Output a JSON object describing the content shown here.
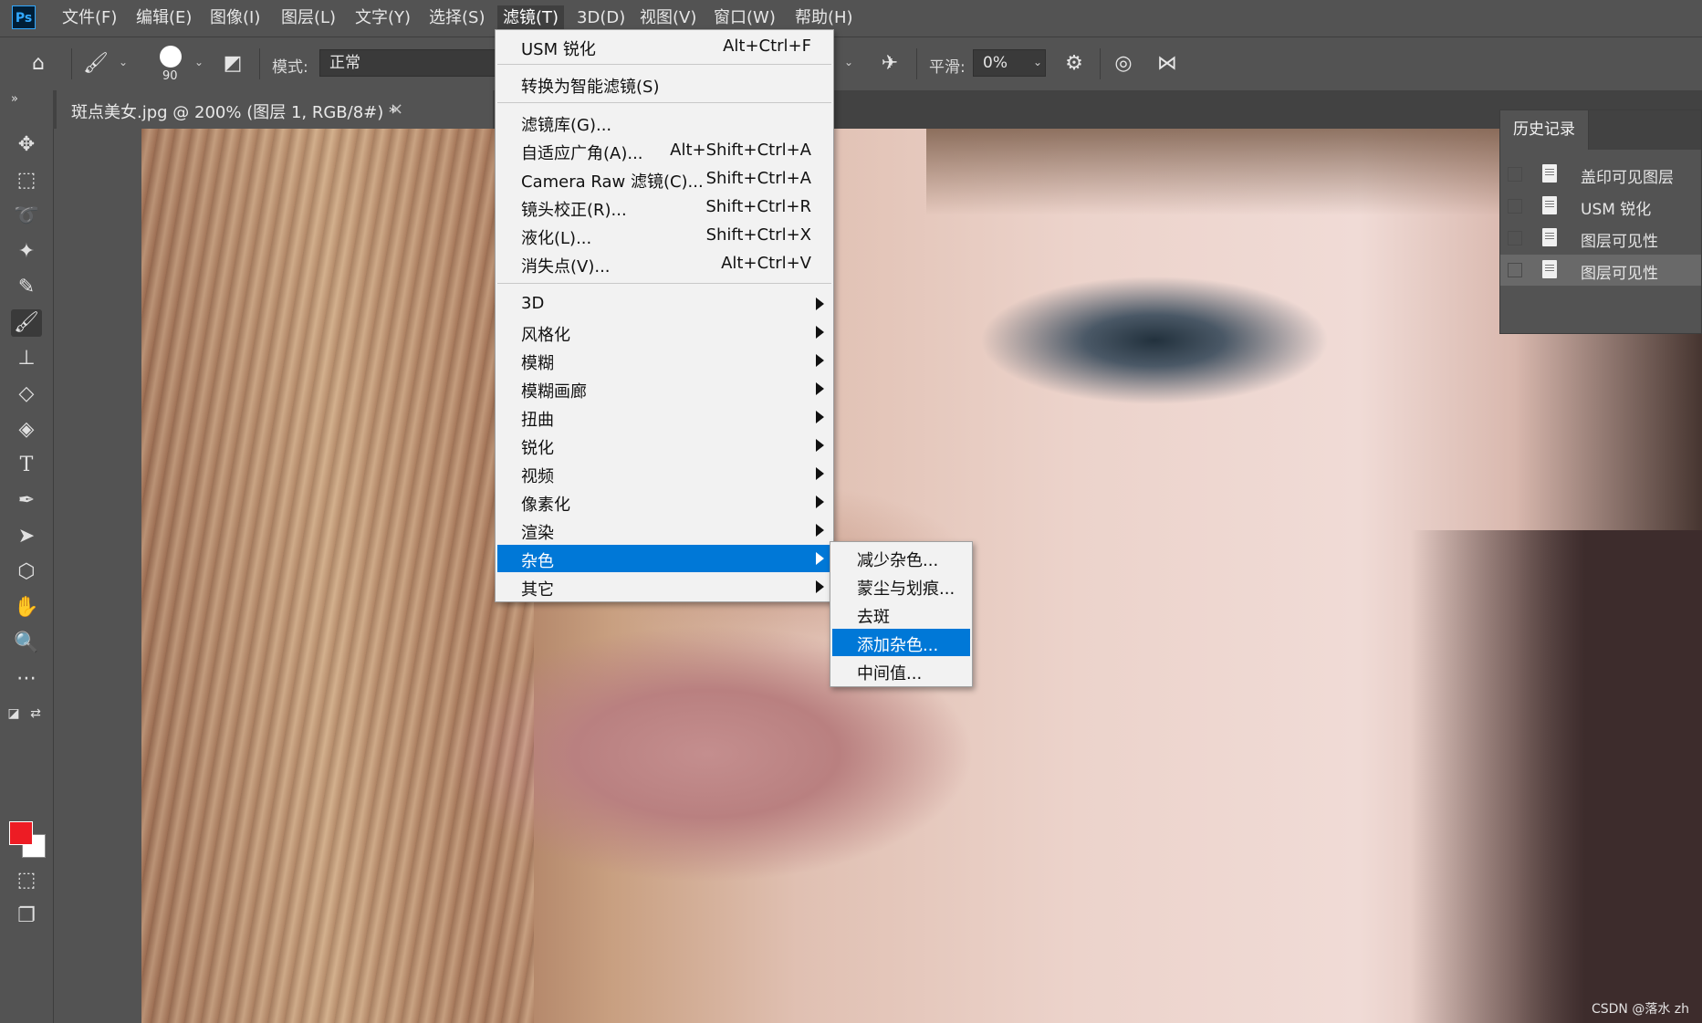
{
  "app": {
    "logo": "Ps",
    "menus": [
      "文件(F)",
      "编辑(E)",
      "图像(I)",
      "图层(L)",
      "文字(Y)",
      "选择(S)",
      "滤镜(T)",
      "3D(D)",
      "视图(V)",
      "窗口(W)",
      "帮助(H)"
    ],
    "active_menu": "滤镜(T)"
  },
  "options_bar": {
    "brush_size": "90",
    "mode_label": "模式:",
    "mode_value": "正常",
    "smoothing_label": "平滑:",
    "smoothing_value": "0%"
  },
  "document_tab": {
    "title": "斑点美女.jpg @ 200% (图层 1, RGB/8#) *",
    "close": "×"
  },
  "filter_menu": {
    "groups": [
      [
        {
          "label": "USM 锐化",
          "shortcut": "Alt+Ctrl+F"
        }
      ],
      [
        {
          "label": "转换为智能滤镜(S)",
          "shortcut": ""
        }
      ],
      [
        {
          "label": "滤镜库(G)...",
          "shortcut": ""
        },
        {
          "label": "自适应广角(A)...",
          "shortcut": "Alt+Shift+Ctrl+A"
        },
        {
          "label": "Camera Raw 滤镜(C)...",
          "shortcut": "Shift+Ctrl+A"
        },
        {
          "label": "镜头校正(R)...",
          "shortcut": "Shift+Ctrl+R"
        },
        {
          "label": "液化(L)...",
          "shortcut": "Shift+Ctrl+X"
        },
        {
          "label": "消失点(V)...",
          "shortcut": "Alt+Ctrl+V"
        }
      ],
      [
        {
          "label": "3D",
          "submenu": true
        },
        {
          "label": "风格化",
          "submenu": true
        },
        {
          "label": "模糊",
          "submenu": true
        },
        {
          "label": "模糊画廊",
          "submenu": true
        },
        {
          "label": "扭曲",
          "submenu": true
        },
        {
          "label": "锐化",
          "submenu": true
        },
        {
          "label": "视频",
          "submenu": true
        },
        {
          "label": "像素化",
          "submenu": true
        },
        {
          "label": "渲染",
          "submenu": true
        },
        {
          "label": "杂色",
          "submenu": true,
          "highlighted": true
        },
        {
          "label": "其它",
          "submenu": true
        }
      ]
    ]
  },
  "noise_submenu": {
    "items": [
      "减少杂色...",
      "蒙尘与划痕...",
      "去斑",
      "添加杂色...",
      "中间值..."
    ],
    "highlighted_index": 3
  },
  "history_panel": {
    "tab": "历史记录",
    "items": [
      "盖印可见图层",
      "USM 锐化",
      "图层可见性",
      "图层可见性"
    ],
    "selected_index": 3
  },
  "watermark": "CSDN @落水 zh",
  "colors": {
    "foreground": "#ed1c24",
    "background": "#ffffff",
    "highlight": "#0078d7"
  }
}
